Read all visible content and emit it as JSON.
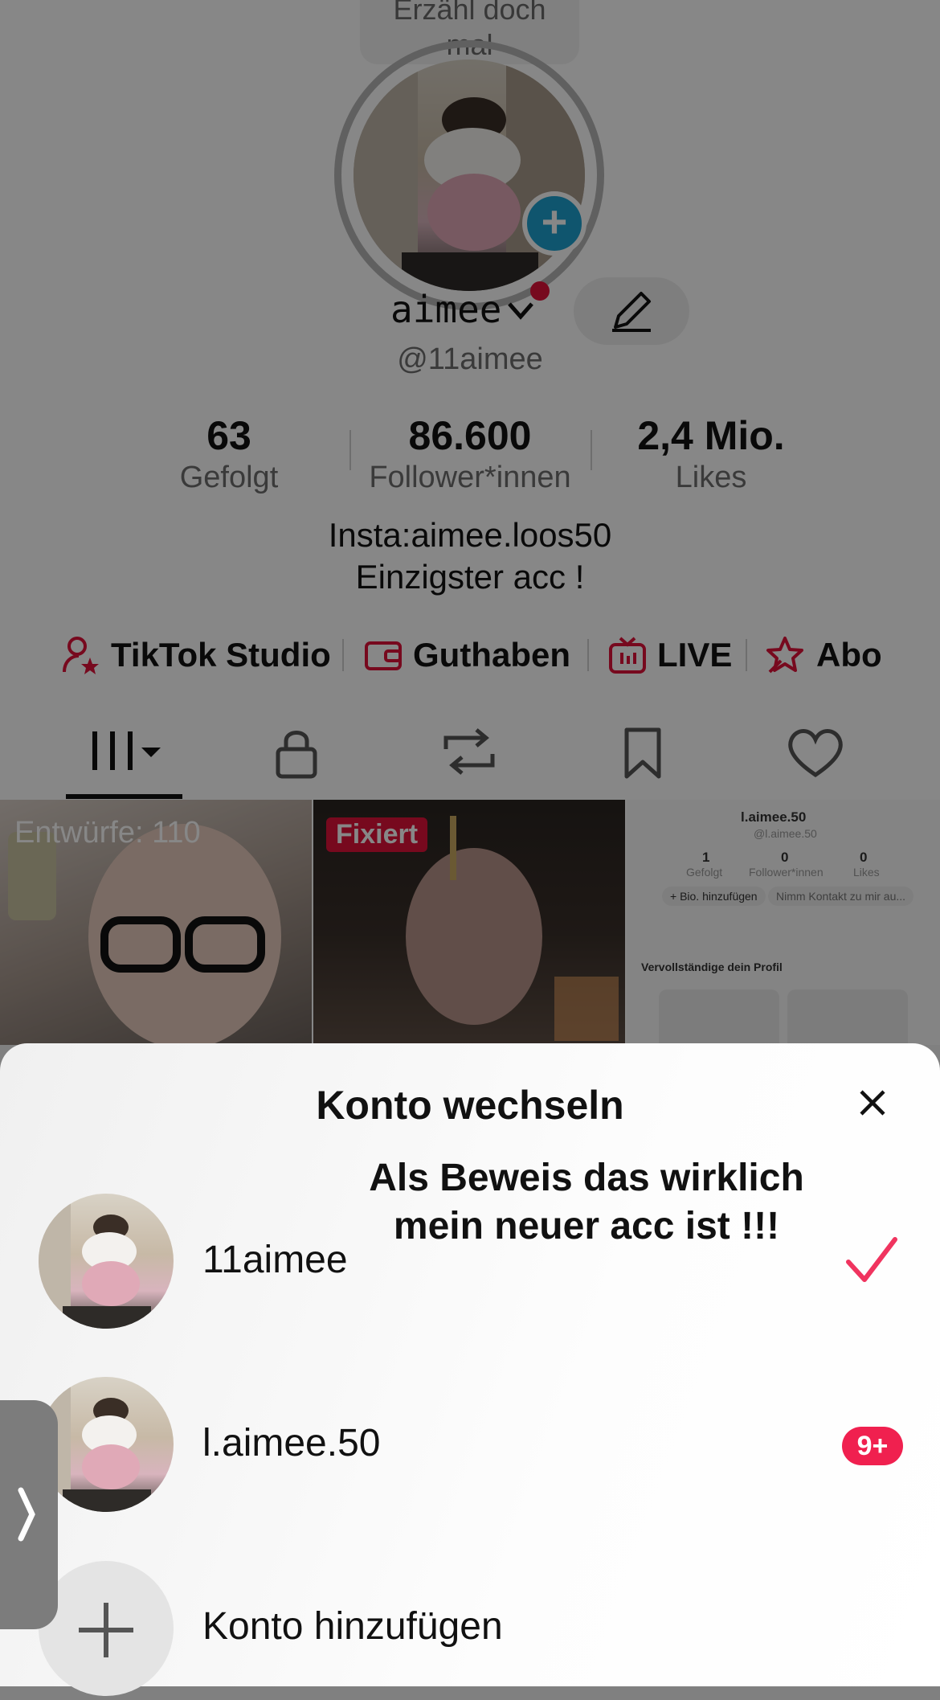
{
  "profile": {
    "bubble_line1": "Erzähl doch",
    "bubble_line2": "mal",
    "name": "aimee",
    "handle": "@11aimee",
    "stats": [
      {
        "value": "63",
        "label": "Gefolgt"
      },
      {
        "value": "86.600",
        "label": "Follower*innen"
      },
      {
        "value": "2,4 Mio.",
        "label": "Likes"
      }
    ],
    "bio_line1": "Insta:aimee.loos50",
    "bio_line2": "Einzigster acc !",
    "quick_links": [
      {
        "label": "TikTok Studio",
        "icon": "tiktok-studio-icon"
      },
      {
        "label": "Guthaben",
        "icon": "wallet-icon"
      },
      {
        "label": "LIVE",
        "icon": "live-tv-icon"
      },
      {
        "label": "Abo",
        "icon": "subscription-star-icon"
      }
    ],
    "tabs": [
      "videos-grid-icon",
      "lock-icon",
      "repost-icon",
      "bookmark-icon",
      "heart-icon"
    ]
  },
  "grid": {
    "drafts_label": "Entwürfe: 110",
    "pinned_label": "Fixiert",
    "mini_profile": {
      "name": "l.aimee.50",
      "handle": "@l.aimee.50",
      "stats": [
        {
          "value": "1",
          "label": "Gefolgt"
        },
        {
          "value": "0",
          "label": "Follower*innen"
        },
        {
          "value": "0",
          "label": "Likes"
        }
      ],
      "bio_button": "+ Bio. hinzufügen",
      "contact_button": "Nimm Kontakt zu mir au...",
      "complete_profile": "Vervollständige dein Profil"
    }
  },
  "sheet": {
    "title": "Konto wechseln",
    "caption_line1": "Als Beweis das wirklich",
    "caption_line2": "mein neuer acc ist !!!",
    "accounts": [
      {
        "name": "11aimee",
        "status": "active"
      },
      {
        "name": "l.aimee.50",
        "notification_badge": "9+"
      }
    ],
    "add_account_label": "Konto hinzufügen"
  },
  "colors": {
    "accent_red": "#e0113a",
    "badge_pink": "#f0204f",
    "plus_blue": "#1da0d0",
    "check_pink": "#f0345f"
  }
}
